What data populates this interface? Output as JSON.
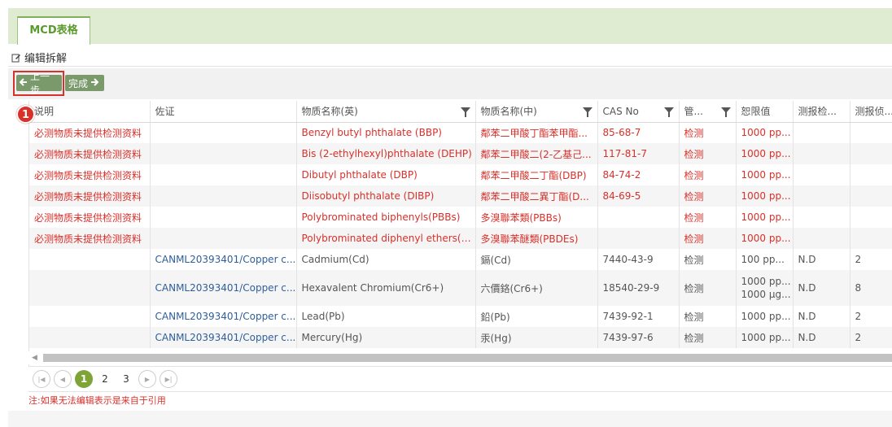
{
  "tab": {
    "label": "MCD表格"
  },
  "section": {
    "title": "编辑拆解"
  },
  "toolbar": {
    "prev_label": "上一步",
    "done_label": "完成"
  },
  "badge": "1",
  "columns": [
    "说明",
    "佐证",
    "物质名称(英)",
    "物质名称(中)",
    "CAS No",
    "管...",
    "恕限值",
    "测报检...",
    "测报侦..."
  ],
  "rows": [
    {
      "note": "必测物质未提供检测资料",
      "proof": "",
      "name_en": "Benzyl butyl phthalate (BBP)",
      "name_cn": "鄰苯二甲酸丁酯苯甲酯...",
      "cas": "85-68-7",
      "manage": "检测",
      "limit": "1000 pp...",
      "detect": "",
      "value": "",
      "style": "red"
    },
    {
      "note": "必测物质未提供检测资料",
      "proof": "",
      "name_en": "Bis (2-ethylhexyl)phthalate (DEHP)",
      "name_cn": "鄰苯二甲酸二(2-乙基己...",
      "cas": "117-81-7",
      "manage": "检测",
      "limit": "1000 pp...",
      "detect": "",
      "value": "",
      "style": "red"
    },
    {
      "note": "必测物质未提供检测资料",
      "proof": "",
      "name_en": "Dibutyl phthalate (DBP)",
      "name_cn": "鄰苯二甲酸二丁酯(DBP)",
      "cas": "84-74-2",
      "manage": "检测",
      "limit": "1000 pp...",
      "detect": "",
      "value": "",
      "style": "red"
    },
    {
      "note": "必测物质未提供检测资料",
      "proof": "",
      "name_en": "Diisobutyl phthalate (DIBP)",
      "name_cn": "鄰苯二甲酸二異丁酯(D...",
      "cas": "84-69-5",
      "manage": "检测",
      "limit": "1000 pp...",
      "detect": "",
      "value": "",
      "style": "red"
    },
    {
      "note": "必测物质未提供检测资料",
      "proof": "",
      "name_en": "Polybrominated biphenyls(PBBs)",
      "name_cn": "多溴聯苯類(PBBs)",
      "cas": "",
      "manage": "检测",
      "limit": "1000 pp...",
      "detect": "",
      "value": "",
      "style": "red"
    },
    {
      "note": "必测物质未提供检测资料",
      "proof": "",
      "name_en": "Polybrominated diphenyl ethers(PB...",
      "name_cn": "多溴聯苯醚類(PBDEs)",
      "cas": "",
      "manage": "检测",
      "limit": "1000 pp...",
      "detect": "",
      "value": "",
      "style": "red"
    },
    {
      "note": "",
      "proof": "CANML20393401/Copper c...",
      "name_en": "Cadmium(Cd)",
      "name_cn": "鎘(Cd)",
      "cas": "7440-43-9",
      "manage": "检测",
      "limit": "100 pp...",
      "detect": "N.D",
      "value": "2",
      "style": "normal"
    },
    {
      "note": "",
      "proof": "CANML20393401/Copper c...",
      "name_en": "Hexavalent Chromium(Cr6+)",
      "name_cn": "六價鉻(Cr6+)",
      "cas": "18540-29-9",
      "manage": "检测",
      "limit": "1000 pp...",
      "limit2": "1000 μg...",
      "detect": "N.D",
      "value": "8",
      "style": "normal"
    },
    {
      "note": "",
      "proof": "CANML20393401/Copper c...",
      "name_en": "Lead(Pb)",
      "name_cn": "鉛(Pb)",
      "cas": "7439-92-1",
      "manage": "检测",
      "limit": "1000 pp...",
      "detect": "N.D",
      "value": "2",
      "style": "normal"
    },
    {
      "note": "",
      "proof": "CANML20393401/Copper c...",
      "name_en": "Mercury(Hg)",
      "name_cn": "汞(Hg)",
      "cas": "7439-97-6",
      "manage": "检测",
      "limit": "1000 pp...",
      "detect": "N.D",
      "value": "2",
      "style": "normal"
    }
  ],
  "pager": {
    "pages": [
      "1",
      "2",
      "3"
    ],
    "current": "1"
  },
  "footnote": "注:如果无法编辑表示是来自于引用"
}
